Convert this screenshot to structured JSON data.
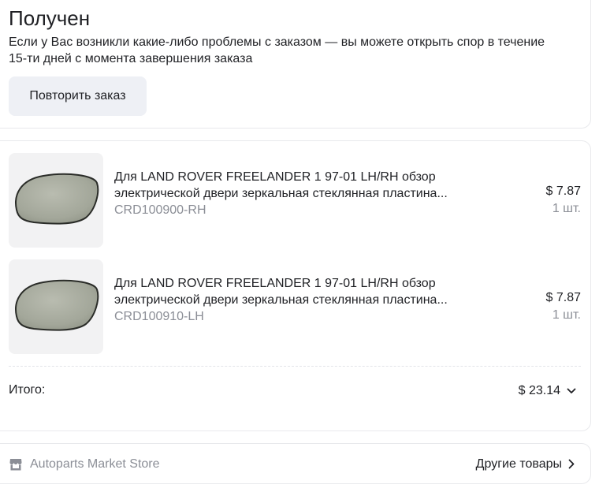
{
  "status": {
    "title": "Получен",
    "description": "Если у Вас возникли какие-либо проблемы с заказом — вы можете открыть спор в течение 15-ти дней с момента завершения заказа",
    "repeat_button_label": "Повторить заказ"
  },
  "items": [
    {
      "title": "Для LAND ROVER FREELANDER 1 97-01 LH/RH обзор электрической двери зеркальная стеклянная пластина...",
      "sku": "CRD100900-RH",
      "price": "$ 7.87",
      "qty": "1 шт.",
      "image_icon": "mirror-glass-image"
    },
    {
      "title": "Для LAND ROVER FREELANDER 1 97-01 LH/RH обзор электрической двери зеркальная стеклянная пластина...",
      "sku": "CRD100910-LH",
      "price": "$ 7.87",
      "qty": "1 шт.",
      "image_icon": "mirror-glass-image"
    }
  ],
  "summary": {
    "total_label": "Итого:",
    "total_value": "$ 23.14",
    "expand_icon": "chevron-down-icon"
  },
  "store": {
    "name": "Autoparts Market Store",
    "icon": "store-icon",
    "other_products_label": "Другие товары",
    "other_products_icon": "chevron-right-icon"
  },
  "colors": {
    "text_primary": "#1f2024",
    "text_secondary": "#8b8e96",
    "button_bg": "#eef0f5",
    "card_border": "#e8e9ec",
    "thumb_bg": "#f2f2f3"
  }
}
